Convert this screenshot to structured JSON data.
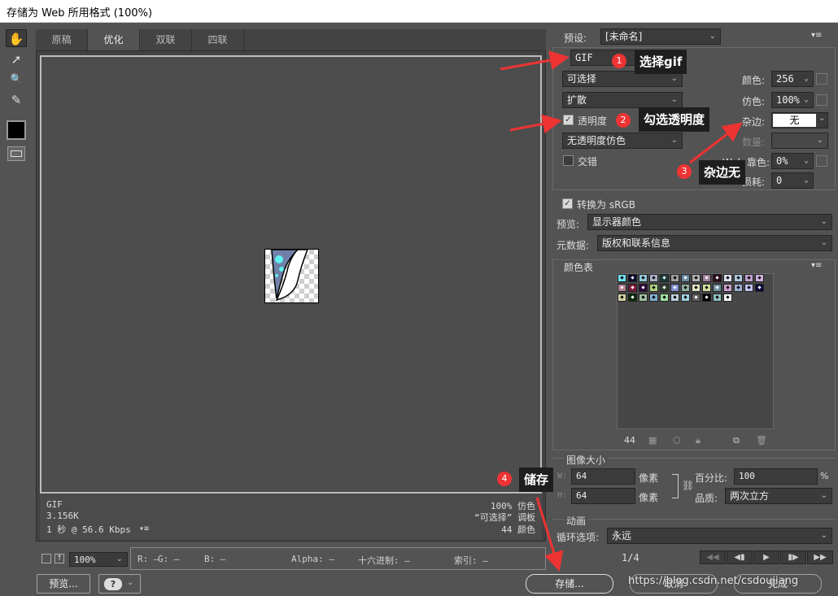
{
  "window": {
    "title": "存储为 Web 所用格式 (100%)"
  },
  "tools": [
    {
      "name": "hand-tool-icon",
      "glyph": "✋"
    },
    {
      "name": "slice-select-tool-icon",
      "glyph": "➚"
    },
    {
      "name": "zoom-tool-icon",
      "glyph": "🔍"
    },
    {
      "name": "eyedropper-tool-icon",
      "glyph": "✎"
    }
  ],
  "tabs": [
    "原稿",
    "优化",
    "双联",
    "四联"
  ],
  "active_tab": "优化",
  "info": {
    "format": "GIF",
    "size": "3.156K",
    "time": "1 秒 @ 56.6 Kbps",
    "dither": "100% 仿色",
    "palette": "“可选择” 调板",
    "colors": "44 颜色"
  },
  "bottom_bar": {
    "zoom": "100%",
    "r_label": "R: —",
    "g_label": "G: —",
    "b_label": "B: —",
    "alpha_label": "Alpha: —",
    "hex_label": "十六进制: —",
    "index_label": "索引: —",
    "preview_btn": "预览...",
    "help_icon": "?"
  },
  "preset": {
    "label": "预设:",
    "value": "[未命名]"
  },
  "settings": {
    "format": "GIF",
    "reduction": "可选择",
    "dither_algo": "扩散",
    "transparency_label": "透明度",
    "transparency_checked": true,
    "transparency_dither": "无透明度仿色",
    "interlaced_label": "交错",
    "interlaced_checked": false,
    "colors_label": "颜色:",
    "colors_value": "256",
    "dither_label": "仿色:",
    "dither_value": "100%",
    "matte_label": "杂边:",
    "matte_value": "无",
    "amount_label": "数量:",
    "web_snap_label": "Web 靠色:",
    "web_snap_value": "0%",
    "lossy_label": "损耗:",
    "lossy_value": "0",
    "convert_srgb_label": "转换为 sRGB",
    "convert_srgb_checked": true,
    "preview_label": "预览:",
    "preview_value": "显示器颜色",
    "metadata_label": "元数据:",
    "metadata_value": "版权和联系信息"
  },
  "color_table": {
    "title": "颜色表",
    "count": "44",
    "swatches": [
      "#6fe0f0",
      "#0a0a2a",
      "#8ec8d8",
      "#a9b3c9",
      "#1a3a3a",
      "#a0a0a0",
      "#6a8aa0",
      "#b0b0b0",
      "#a080a0",
      "#2a0a1a",
      "#e0e0f0",
      "#b0c8e0",
      "#c0a0d0",
      "#d0b0e0",
      "#b08090",
      "#7a1a3a",
      "#2a0a3a",
      "#b0d080",
      "#304030",
      "#8090d0",
      "#90b0a0",
      "#e0e0c0",
      "#d0e0a0",
      "#7090a0",
      "#d0a0d0",
      "#a0b0d0",
      "#c0c0f0",
      "#0a0a3a",
      "#d0d0a0",
      "#0a2a0a",
      "#a0c0a0",
      "#80b0d0",
      "#a0e0a0",
      "#c0d0e0",
      "#a0d0e0",
      "#606060",
      "#000000",
      "#90c0c0",
      "#ffffff"
    ]
  },
  "image_size": {
    "title": "图像大小",
    "w_label": "W:",
    "w_value": "64",
    "h_label": "H:",
    "h_value": "64",
    "unit": "像素",
    "percent_label": "百分比:",
    "percent_value": "100",
    "percent_unit": "%",
    "quality_label": "品质:",
    "quality_value": "两次立方"
  },
  "animation": {
    "title": "动画",
    "loop_label": "循环选项:",
    "loop_value": "永远",
    "frame": "1/4"
  },
  "buttons": {
    "save": "存储...",
    "cancel": "取消",
    "done": "完成"
  },
  "annotations": [
    {
      "num": "1",
      "text": "选择gif"
    },
    {
      "num": "2",
      "text": "勾选透明度"
    },
    {
      "num": "3",
      "text": "杂边无"
    },
    {
      "num": "4",
      "text": "储存"
    }
  ],
  "watermark": "https://blog.csdn.net/csdoujiang",
  "colors": {
    "accent_red": "#e33333",
    "panel_bg": "#535353",
    "field_bg": "#3b3b3b"
  }
}
